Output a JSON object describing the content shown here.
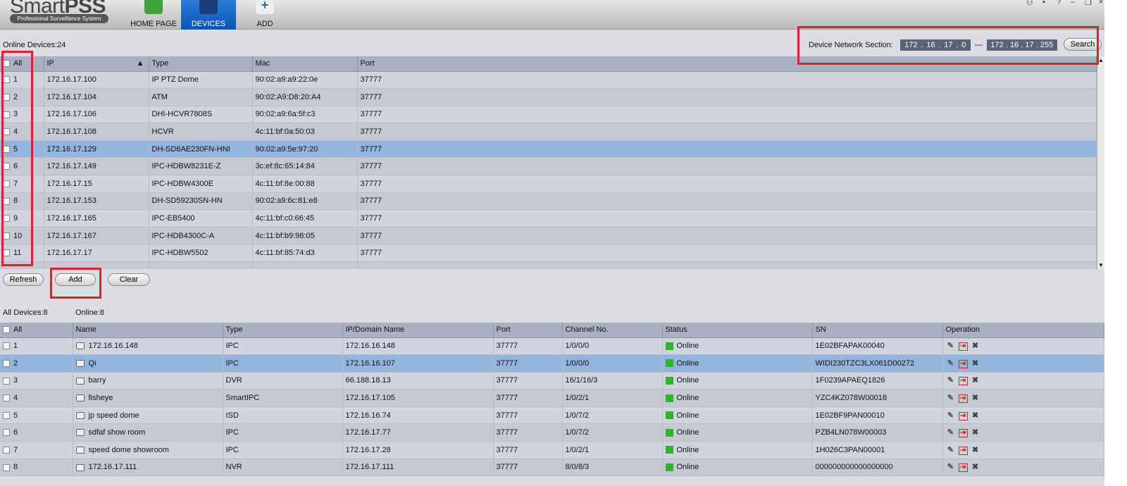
{
  "app": {
    "logo": "SmartPSS",
    "logo_bold": "PSS",
    "logo_plain": "Smart",
    "subtitle": "Professional Surveillance System"
  },
  "nav": [
    {
      "label": "HOME PAGE"
    },
    {
      "label": "DEVICES"
    },
    {
      "label": "ADD"
    }
  ],
  "window_controls": [
    "user",
    "lock",
    "?",
    "–",
    "restore",
    "×"
  ],
  "search": {
    "online_devices": "Online Devices:24",
    "section_label": "Device Network Section:",
    "start_ip": [
      "172",
      "16",
      "17",
      "0"
    ],
    "end_ip": [
      "172",
      "16",
      "17",
      "255"
    ],
    "dash": "—",
    "button": "Search"
  },
  "online_table": {
    "headers": [
      "All",
      "IP",
      "Type",
      "Mac",
      "Port"
    ],
    "sort_indicator": "▲",
    "rows": [
      [
        "1",
        "172.16.17.100",
        "IP PTZ Dome",
        "90:02:a9:a9:22:0e",
        "37777"
      ],
      [
        "2",
        "172.16.17.104",
        "ATM",
        "90:02:A9:D8:20:A4",
        "37777"
      ],
      [
        "3",
        "172.16.17.106",
        "DHI-HCVR7808S",
        "90:02:a9:6a:5f:c3",
        "37777"
      ],
      [
        "4",
        "172.16.17.108",
        "HCVR",
        "4c:11:bf:0a:50:03",
        "37777"
      ],
      [
        "5",
        "172.16.17.129",
        "DH-SD6AE230FN-HNI",
        "90:02:a9:5e:97:20",
        "37777"
      ],
      [
        "6",
        "172.16.17.149",
        "IPC-HDBW8231E-Z",
        "3c:ef:8c:65:14:84",
        "37777"
      ],
      [
        "7",
        "172.16.17.15",
        "IPC-HDBW4300E",
        "4c:11:bf:8e:00:88",
        "37777"
      ],
      [
        "8",
        "172.16.17.153",
        "DH-SD59230SN-HN",
        "90:02:a9:6c:81:e8",
        "37777"
      ],
      [
        "9",
        "172.16.17.165",
        "IPC-EB5400",
        "4c:11:bf:c0:66:45",
        "37777"
      ],
      [
        "10",
        "172.16.17.167",
        "IPC-HDB4300C-A",
        "4c:11:bf:b9:98:05",
        "37777"
      ],
      [
        "11",
        "172.16.17.17",
        "IPC-HDBW5502",
        "4c:11:bf:85:74:d3",
        "37777"
      ]
    ],
    "selected_row": 4
  },
  "actions": {
    "refresh": "Refresh",
    "add": "Add",
    "clear": "Clear"
  },
  "added": {
    "all_devices": "All Devices:8",
    "online": "Online:8"
  },
  "device_table": {
    "headers": [
      "All",
      "Name",
      "Type",
      "IP/Domain Name",
      "Port",
      "Channel No.",
      "Status",
      "SN",
      "Operation"
    ],
    "rows": [
      [
        "1",
        "172.16.16.148",
        "IPC",
        "172.16.16.148",
        "37777",
        "1/0/0/0",
        "Online",
        "1E02BFAPAK00040"
      ],
      [
        "2",
        "Qi",
        "IPC",
        "172.16.16.107",
        "37777",
        "1/0/0/0",
        "Online",
        "WIDI230TZC3LX061D00272"
      ],
      [
        "3",
        "barry",
        "DVR",
        "66.188.18.13",
        "37777",
        "16/1/16/3",
        "Online",
        "1F0239APAEQ1826"
      ],
      [
        "4",
        "fisheye",
        "SmartIPC",
        "172.16.17.105",
        "37777",
        "1/0/2/1",
        "Online",
        "YZC4KZ078W00018"
      ],
      [
        "5",
        "jp speed dome",
        "ISD",
        "172.16.16.74",
        "37777",
        "1/0/7/2",
        "Online",
        "1E02BF9PAN00010"
      ],
      [
        "6",
        "sdfaf show room",
        "IPC",
        "172.16.17.77",
        "37777",
        "1/0/7/2",
        "Online",
        "PZB4LN078W00003"
      ],
      [
        "7",
        "speed dome showroom",
        "IPC",
        "172.16.17.28",
        "37777",
        "1/0/2/1",
        "Online",
        "1H026C3PAN00001"
      ],
      [
        "8",
        "172.16.17.111",
        "NVR",
        "172.16.17.111",
        "37777",
        "8/0/8/3",
        "Online",
        "000000000000000000"
      ]
    ],
    "selected_row": 1
  },
  "colors": {
    "accent": "#0a55b8",
    "online": "#2bb52b",
    "selection": "#93b4dd",
    "annotation": "#e02028"
  }
}
